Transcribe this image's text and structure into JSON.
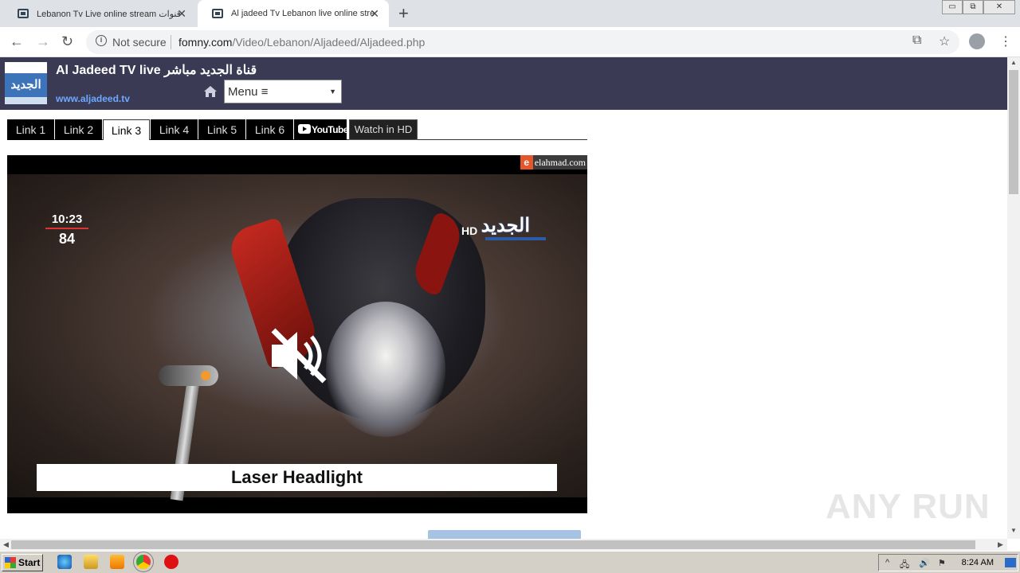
{
  "browser": {
    "tabs": [
      {
        "title": "Lebanon Tv Live online stream قنوات",
        "active": false
      },
      {
        "title": "Al jadeed Tv Lebanon live online stre",
        "active": true
      }
    ],
    "new_tab": "+",
    "close_glyph": "✕",
    "window_controls": [
      "▭",
      "⧉",
      "✕"
    ],
    "nav": {
      "back": "←",
      "forward": "→",
      "reload": "↻"
    },
    "security_icon": "i",
    "security_label": "Not secure",
    "url_host": "fomny.com",
    "url_path": "/Video/Lebanon/Aljadeed/Aljadeed.php",
    "toolbar_icons": {
      "translate": "⧉",
      "bookmark": "☆",
      "menu": "⋮"
    }
  },
  "site": {
    "logo_text": "الجديد",
    "title": "Al Jadeed TV live قناة الجديد مباشر",
    "website": "www.aljadeed.tv",
    "menu_label": "Menu ≡",
    "menu_arrow": "▼"
  },
  "links": {
    "tabs": [
      "Link 1",
      "Link 2",
      "Link 3",
      "Link 4",
      "Link 5",
      "Link 6"
    ],
    "active_index": 2,
    "youtube": "YouTube",
    "watch_hd": "Watch in HD"
  },
  "video": {
    "watermark_e": "e",
    "watermark": "elahmad.com",
    "clock_time": "10:23",
    "temperature": "84",
    "channel_hd": "HD",
    "channel_name": "الجديد",
    "caption": "Laser Headlight",
    "muted": true
  },
  "scrollbar_glyphs": {
    "up": "▲",
    "down": "▼",
    "left": "◀",
    "right": "▶"
  },
  "overlay_watermark": "ANY RUN",
  "taskbar": {
    "start_label": "Start",
    "time": "8:24 AM",
    "tray_icons": [
      "^",
      "🖧",
      "🔊",
      "⚑"
    ]
  },
  "colors": {
    "header_bg": "#3a3a54",
    "site_link": "#6fa8ff",
    "logo_band": "#3d73b8",
    "watermark_e": "#e5572a"
  }
}
